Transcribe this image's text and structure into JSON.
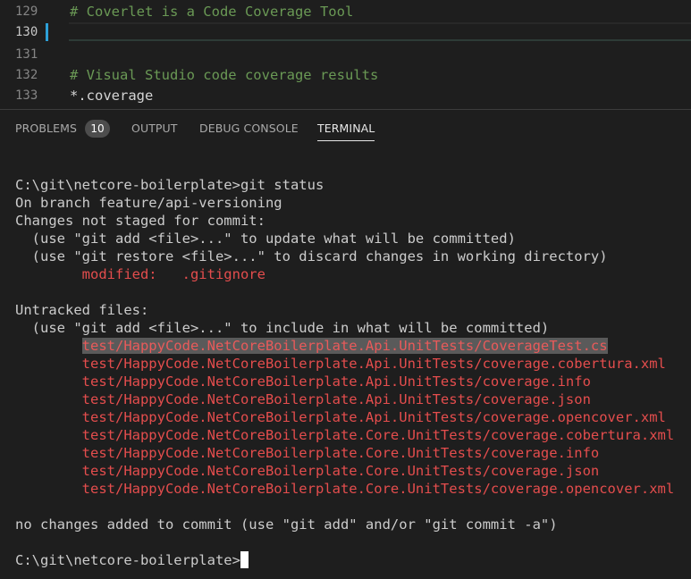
{
  "editor": {
    "lines": [
      {
        "number": "129",
        "text": "# Coverlet is a Code Coverage Tool",
        "kind": "comment"
      },
      {
        "number": "130",
        "text": "",
        "kind": "plain"
      },
      {
        "number": "131",
        "text": "",
        "kind": "plain"
      },
      {
        "number": "132",
        "text": "# Visual Studio code coverage results",
        "kind": "comment"
      },
      {
        "number": "133",
        "text": "*.coverage",
        "kind": "plain"
      }
    ]
  },
  "panel": {
    "tabs": {
      "problems": "PROBLEMS",
      "problems_count": "10",
      "output": "OUTPUT",
      "debug_console": "DEBUG CONSOLE",
      "terminal": "TERMINAL"
    }
  },
  "terminal": {
    "command_line": "C:\\git\\netcore-boilerplate>git status",
    "branch": "On branch feature/api-versioning",
    "changes_header": "Changes not staged for commit:",
    "hint_add": "  (use \"git add <file>...\" to update what will be committed)",
    "hint_restore": "  (use \"git restore <file>...\" to discard changes in working directory)",
    "modified_label": "        modified:   ",
    "modified_file": ".gitignore",
    "untracked_header": "Untracked files:",
    "untracked_hint": "  (use \"git add <file>...\" to include in what will be committed)",
    "untracked_indent": "        ",
    "untracked_files": [
      "test/HappyCode.NetCoreBoilerplate.Api.UnitTests/CoverageTest.cs",
      "test/HappyCode.NetCoreBoilerplate.Api.UnitTests/coverage.cobertura.xml",
      "test/HappyCode.NetCoreBoilerplate.Api.UnitTests/coverage.info",
      "test/HappyCode.NetCoreBoilerplate.Api.UnitTests/coverage.json",
      "test/HappyCode.NetCoreBoilerplate.Api.UnitTests/coverage.opencover.xml",
      "test/HappyCode.NetCoreBoilerplate.Core.UnitTests/coverage.cobertura.xml",
      "test/HappyCode.NetCoreBoilerplate.Core.UnitTests/coverage.info",
      "test/HappyCode.NetCoreBoilerplate.Core.UnitTests/coverage.json",
      "test/HappyCode.NetCoreBoilerplate.Core.UnitTests/coverage.opencover.xml"
    ],
    "summary": "no changes added to commit (use \"git add\" and/or \"git commit -a\")",
    "prompt": "C:\\git\\netcore-boilerplate>"
  },
  "colors": {
    "background": "#1e1e1e",
    "comment": "#6a9955",
    "terminal_text": "#cccccc",
    "git_red": "#e44d4d",
    "accent_gutter": "#2da0d8"
  }
}
